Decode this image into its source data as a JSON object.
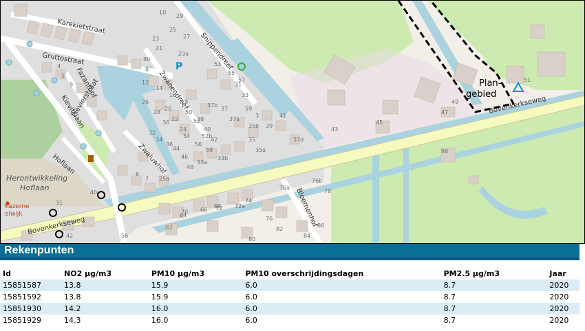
{
  "map": {
    "streets": {
      "karekietstraat": "Karekietstraat",
      "gruttostraat": "Gruttostraat",
      "fazanthof": "Fazanthof",
      "plevierstraat": "Plevierstraat",
      "kievitslaan": "Kievitslaan",
      "zwanendreef": "Zwanendreef",
      "snippendreef": "Snippendreef",
      "zwaluwhof": "Zwaluwhof",
      "hoflaan": "Hoflaan",
      "bovenkerkseweg_left": "Bovenkerkseweg",
      "bovenkerkseweg_right": "Bovenkerkseweg",
      "bloemenhof": "Bloemenhof"
    },
    "area_labels": {
      "herontwikkeling_1": "Herontwikkeling",
      "herontwikkeling_2": "Hoflaan",
      "kazerne_1": "kazerne",
      "kazerne_2": "olwijk",
      "plangebied_1": "Plan-",
      "plangebied_2": "gebied"
    },
    "house_numbers": [
      "4",
      "5",
      "9",
      "10",
      "29",
      "25",
      "23",
      "21",
      "27",
      "23a",
      "8b",
      "8",
      "12",
      "14",
      "16",
      "18",
      "20",
      "22",
      "24",
      "26",
      "28",
      "30",
      "32",
      "34",
      "36",
      "38",
      "40",
      "42",
      "44",
      "46",
      "48",
      "50",
      "52",
      "52b",
      "54",
      "56",
      "58",
      "31",
      "33",
      "33a",
      "33b",
      "35",
      "35a",
      "35b",
      "37",
      "37a",
      "37b",
      "37d",
      "39",
      "41",
      "43",
      "45",
      "47",
      "49",
      "51",
      "53",
      "55",
      "57",
      "59",
      "3",
      "6",
      "7",
      "25a",
      "31",
      "40",
      "42",
      "56",
      "62",
      "64",
      "66",
      "68",
      "70",
      "72",
      "72a",
      "74",
      "76",
      "76a",
      "76b",
      "78",
      "80",
      "82",
      "84",
      "86",
      "88"
    ],
    "icons": {
      "parking": "P"
    }
  },
  "panel": {
    "title": "Rekenpunten",
    "columns": [
      "Id",
      "NO2 µg/m3",
      "PM10 µg/m3",
      "PM10 overschrijdingsdagen",
      "PM2.5 µg/m3",
      "Jaar"
    ],
    "rows": [
      [
        "15851587",
        "13.8",
        "15.9",
        "6.0",
        "8.7",
        "2020"
      ],
      [
        "15851592",
        "13.8",
        "15.9",
        "6.0",
        "8.7",
        "2020"
      ],
      [
        "15851930",
        "14.2",
        "16.0",
        "6.0",
        "8.7",
        "2020"
      ],
      [
        "15851929",
        "14.3",
        "16.0",
        "6.0",
        "8.7",
        "2020"
      ]
    ]
  },
  "colors": {
    "header_bg": "#0b6e96",
    "row_alt": "#dcecf4",
    "water": "#aad3df",
    "grass": "#cdebb0",
    "building": "#d9d0c9",
    "road": "#ffffff",
    "main_road": "#f7fabf",
    "plangebied_border": "#000000"
  }
}
